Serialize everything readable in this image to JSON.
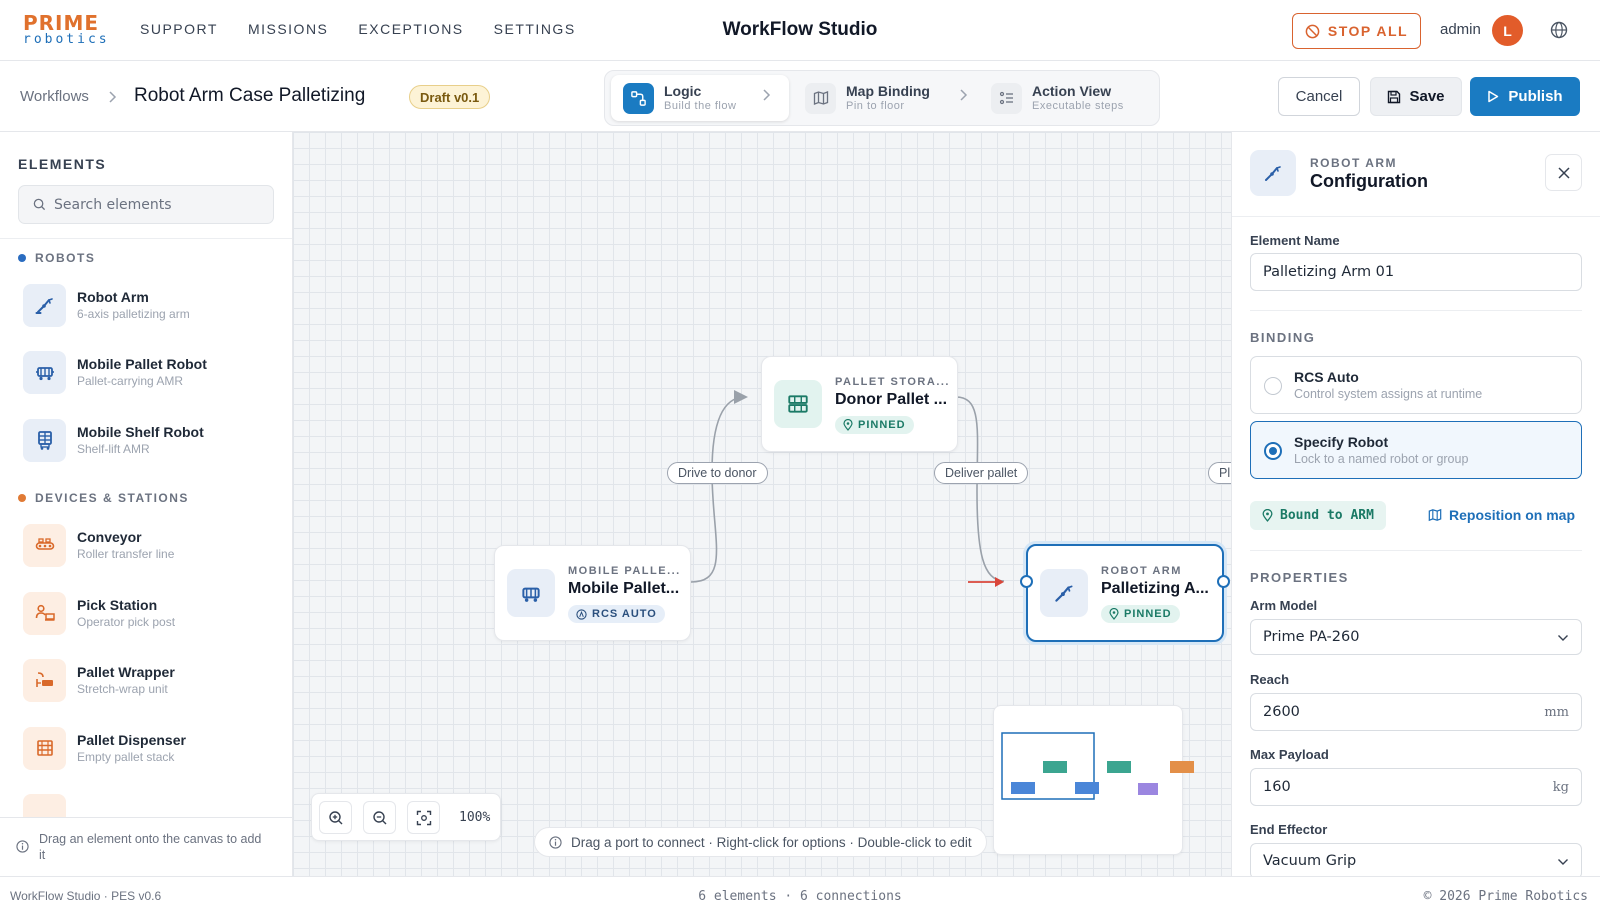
{
  "brand": {
    "line1": "PRIME",
    "line2": "robotics"
  },
  "nav": {
    "items": [
      "SUPPORT",
      "MISSIONS",
      "EXCEPTIONS",
      "SETTINGS"
    ]
  },
  "app_title": "WorkFlow Studio",
  "header": {
    "stop_all": "STOP ALL",
    "user": "admin",
    "avatar_initial": "L"
  },
  "breadcrumb": {
    "root": "Workflows",
    "current": "Robot Arm Case Palletizing"
  },
  "draft_badge": "Draft v0.1",
  "steps": [
    {
      "label": "Logic",
      "sub": "Build the flow"
    },
    {
      "label": "Map Binding",
      "sub": "Pin to floor"
    },
    {
      "label": "Action View",
      "sub": "Executable steps"
    }
  ],
  "actions": {
    "cancel": "Cancel",
    "save": "Save",
    "publish": "Publish"
  },
  "elements_panel": {
    "title": "ELEMENTS",
    "search_placeholder": "Search elements",
    "categories": [
      {
        "name": "ROBOTS",
        "color": "#2a6cc0"
      },
      {
        "name": "DEVICES & STATIONS",
        "color": "#e07a35"
      }
    ],
    "items": [
      {
        "name": "Robot Arm",
        "sub": "6-axis palletizing arm",
        "icon": "robot-arm-icon"
      },
      {
        "name": "Mobile Pallet Robot",
        "sub": "Pallet-carrying AMR",
        "icon": "mobile-robot-icon"
      },
      {
        "name": "Mobile Shelf Robot",
        "sub": "Shelf-lift AMR",
        "icon": "shelf-robot-icon"
      },
      {
        "name": "Conveyor",
        "sub": "Roller transfer line",
        "icon": "conveyor-icon"
      },
      {
        "name": "Pick Station",
        "sub": "Operator pick post",
        "icon": "pick-station-icon"
      },
      {
        "name": "Pallet Wrapper",
        "sub": "Stretch-wrap unit",
        "icon": "wrapper-icon"
      },
      {
        "name": "Pallet Dispenser",
        "sub": "Empty pallet stack",
        "icon": "dispenser-icon"
      }
    ],
    "footer_hint": "Drag an element onto the canvas to add it"
  },
  "canvas": {
    "nodes": [
      {
        "type": "MOBILE PALLE...",
        "title": "Mobile Pallet...",
        "badge": "RCS AUTO"
      },
      {
        "type": "PALLET STORA...",
        "title": "Donor Pallet ...",
        "badge": "PINNED"
      },
      {
        "type": "ROBOT ARM",
        "title": "Palletizing A...",
        "badge": "PINNED"
      }
    ],
    "edge_labels": [
      "Drive to donor",
      "Deliver pallet",
      "Pl"
    ],
    "zoom": "100%",
    "hint": "Drag a port to connect · Right-click for options · Double-click to edit"
  },
  "config_panel": {
    "kind": "ROBOT ARM",
    "title": "Configuration",
    "element_name_label": "Element Name",
    "element_name_value": "Palletizing Arm 01",
    "binding_section": "BINDING",
    "binding_options": [
      {
        "title": "RCS Auto",
        "sub": "Control system assigns at runtime",
        "selected": false
      },
      {
        "title": "Specify Robot",
        "sub": "Lock to a named robot or group",
        "selected": true
      }
    ],
    "bound_chip": "Bound to ARM",
    "reposition": "Reposition on map",
    "properties_section": "PROPERTIES",
    "arm_model_label": "Arm Model",
    "arm_model_value": "Prime PA-260",
    "reach_label": "Reach",
    "reach_value": "2600",
    "reach_unit": "mm",
    "payload_label": "Max Payload",
    "payload_value": "160",
    "payload_unit": "kg",
    "effector_label": "End Effector",
    "effector_value": "Vacuum Grip"
  },
  "footer": {
    "left": "WorkFlow Studio · PES v0.6",
    "middle": "6 elements · 6 connections",
    "right": "© 2026 Prime Robotics"
  },
  "colors": {
    "accent": "#1e6fb8",
    "brand_orange": "#e0712d",
    "publish": "#1a7bc2",
    "teal": "#1b7a66"
  }
}
